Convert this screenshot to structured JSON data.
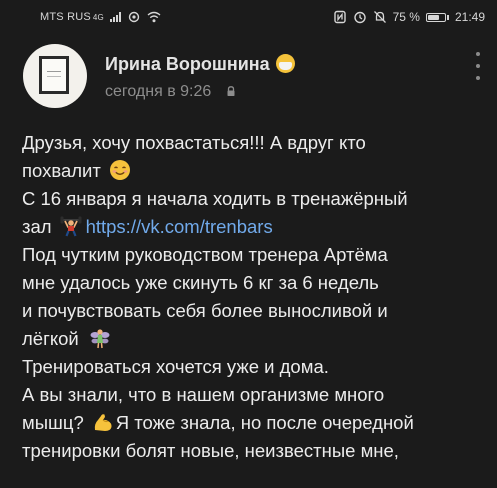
{
  "status_bar": {
    "carrier": "MTS RUS",
    "network": "4G",
    "battery_text": "75 %",
    "battery_level": 0.75,
    "time": "21:49",
    "icons": [
      "signal-icon",
      "eye-comfort-icon",
      "wifi-icon",
      "nfc-icon",
      "alarm-icon",
      "mute-icon",
      "battery-icon"
    ]
  },
  "post": {
    "author_name": "Ирина Ворошнина",
    "time": "сегодня в 9:26",
    "author_emoji": "mask-emoji",
    "lines": {
      "l1": "Друзья, хочу похвастаться!!! А вдруг кто",
      "l2": "похвалит",
      "l3": "С 16 января я начала ходить в тренажёрный",
      "l4a": "зал",
      "l4link": "https://vk.com/trenbars",
      "l5": "Под чутким руководством тренера Артёма",
      "l6": "мне удалось уже скинуть 6 кг за 6 недель",
      "l7": "и почувствовать себя более выносливой и",
      "l8": "лёгкой",
      "l9": "Тренироваться хочется уже и дома.",
      "l10": "А вы знали, что в нашем организме много",
      "l11a": "мышц?",
      "l11b": "Я тоже знала, но  после очередной",
      "l12": "тренировки болят новые, неизвестные мне,"
    },
    "emojis": {
      "blush": "blush-emoji",
      "weightlifter": "weightlifter-emoji",
      "fairy": "fairy-emoji",
      "muscle": "flexed-biceps-emoji"
    }
  }
}
